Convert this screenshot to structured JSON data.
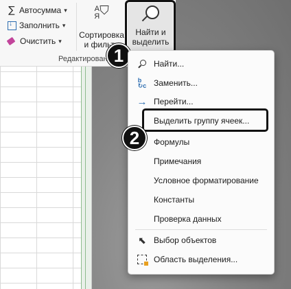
{
  "ribbon": {
    "autosum_label": "Автосумма",
    "fill_label": "Заполнить",
    "clear_label": "Очистить",
    "sort_filter_line1": "Сортировка",
    "sort_filter_line2": "и фильтр",
    "find_select_line1": "Найти и",
    "find_select_line2": "выделить",
    "group_label": "Редактирование"
  },
  "callouts": {
    "step1": "1",
    "step2": "2"
  },
  "menu": {
    "items": [
      {
        "label": "Найти...",
        "icon": "search-icon"
      },
      {
        "label": "Заменить...",
        "icon": "replace-icon"
      },
      {
        "label": "Перейти...",
        "icon": "goto-arrow-icon"
      },
      {
        "label": "Выделить группу ячеек...",
        "icon": ""
      },
      {
        "label": "Формулы",
        "icon": ""
      },
      {
        "label": "Примечания",
        "icon": ""
      },
      {
        "label": "Условное форматирование",
        "icon": ""
      },
      {
        "label": "Константы",
        "icon": ""
      },
      {
        "label": "Проверка данных",
        "icon": ""
      },
      {
        "label": "Выбор объектов",
        "icon": "cursor-icon"
      },
      {
        "label": "Область выделения...",
        "icon": "selection-pane-icon"
      }
    ]
  },
  "colors": {
    "accent_blue": "#2b6cb0",
    "callout_black": "#111111",
    "menu_bg": "#fbfbfb"
  }
}
